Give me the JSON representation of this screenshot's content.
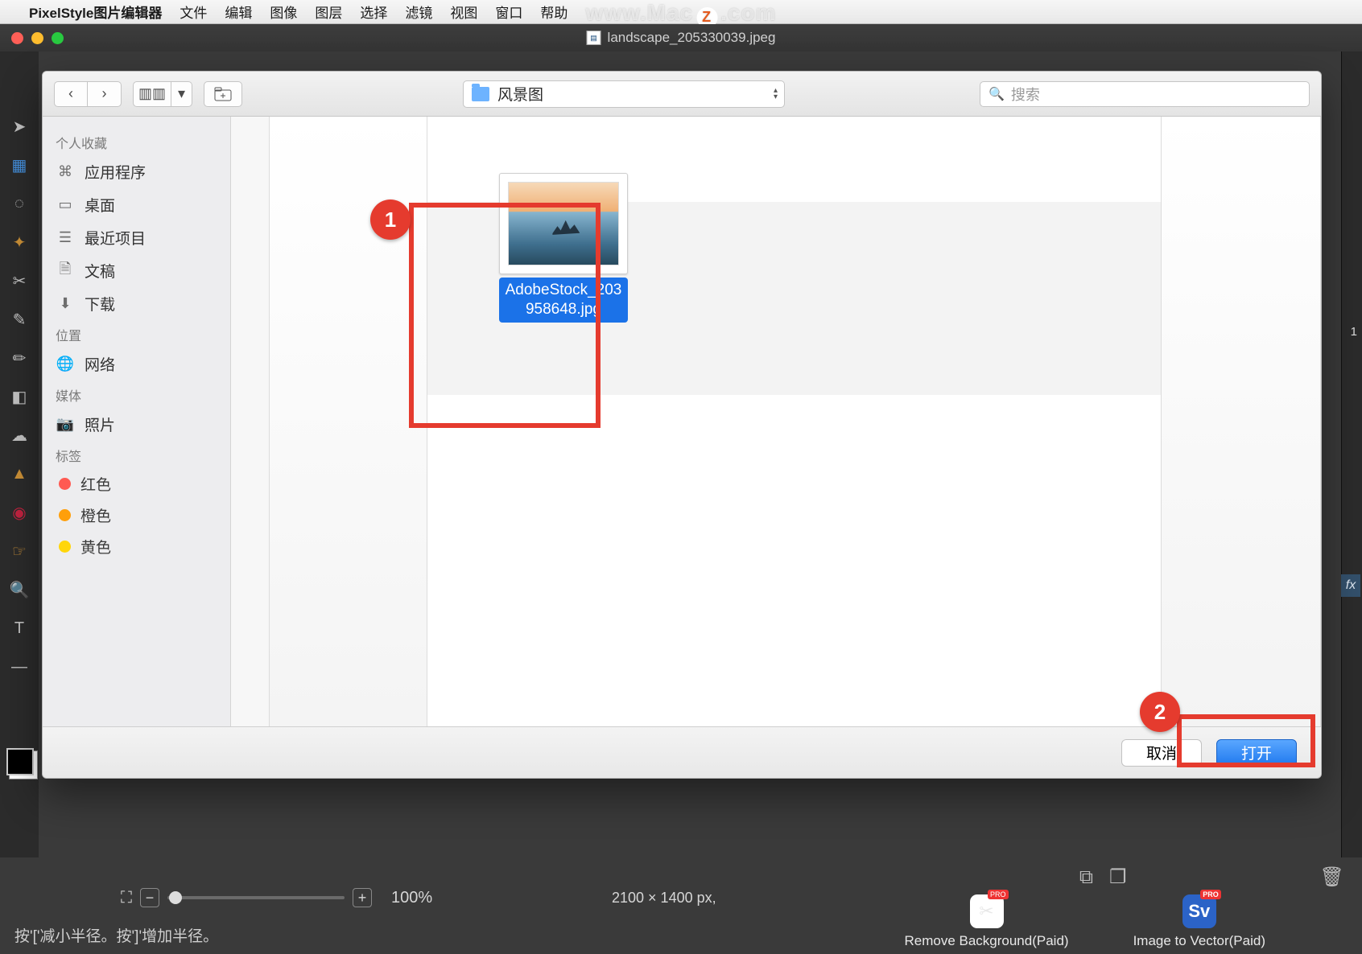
{
  "menubar": {
    "app_name": "PixelStyle图片编辑器",
    "items": [
      "文件",
      "编辑",
      "图像",
      "图层",
      "选择",
      "滤镜",
      "视图",
      "窗口",
      "帮助"
    ],
    "watermark_left": "www.Mac",
    "watermark_badge": "Z",
    "watermark_right": ".com"
  },
  "editor": {
    "document_title": "landscape_205330039.jpeg",
    "right_panel_number": "1",
    "fx_label": "fx",
    "zoom_percent": "100%",
    "canvas_dims": "2100 × 1400 px,",
    "hint": "按'['减小半径。按']'增加半径。",
    "apps": [
      {
        "label": "Remove Background(Paid)",
        "glyph": "✂",
        "class": ""
      },
      {
        "label": "Image to Vector(Paid)",
        "glyph": "Sv",
        "class": "sv"
      }
    ]
  },
  "dialog": {
    "path_label": "风景图",
    "search_placeholder": "搜索",
    "sidebar": {
      "favorites_head": "个人收藏",
      "favorites": [
        {
          "icon": "⌘",
          "label": "应用程序"
        },
        {
          "icon": "▭",
          "label": "桌面"
        },
        {
          "icon": "☰",
          "label": "最近项目"
        },
        {
          "icon": "🗎",
          "label": "文稿"
        },
        {
          "icon": "⬇",
          "label": "下载"
        }
      ],
      "locations_head": "位置",
      "locations": [
        {
          "icon": "🌐",
          "label": "网络"
        }
      ],
      "media_head": "媒体",
      "media": [
        {
          "icon": "📷",
          "label": "照片"
        }
      ],
      "tags_head": "标签",
      "tags": [
        {
          "color": "#ff5a52",
          "label": "红色"
        },
        {
          "color": "#ff9f0a",
          "label": "橙色"
        },
        {
          "color": "#ffd60a",
          "label": "黄色"
        }
      ]
    },
    "file": {
      "name_line1": "AdobeStock_203",
      "name_line2": "958648.jpg"
    },
    "buttons": {
      "cancel": "取消",
      "open": "打开"
    },
    "callouts": {
      "one": "1",
      "two": "2"
    }
  }
}
